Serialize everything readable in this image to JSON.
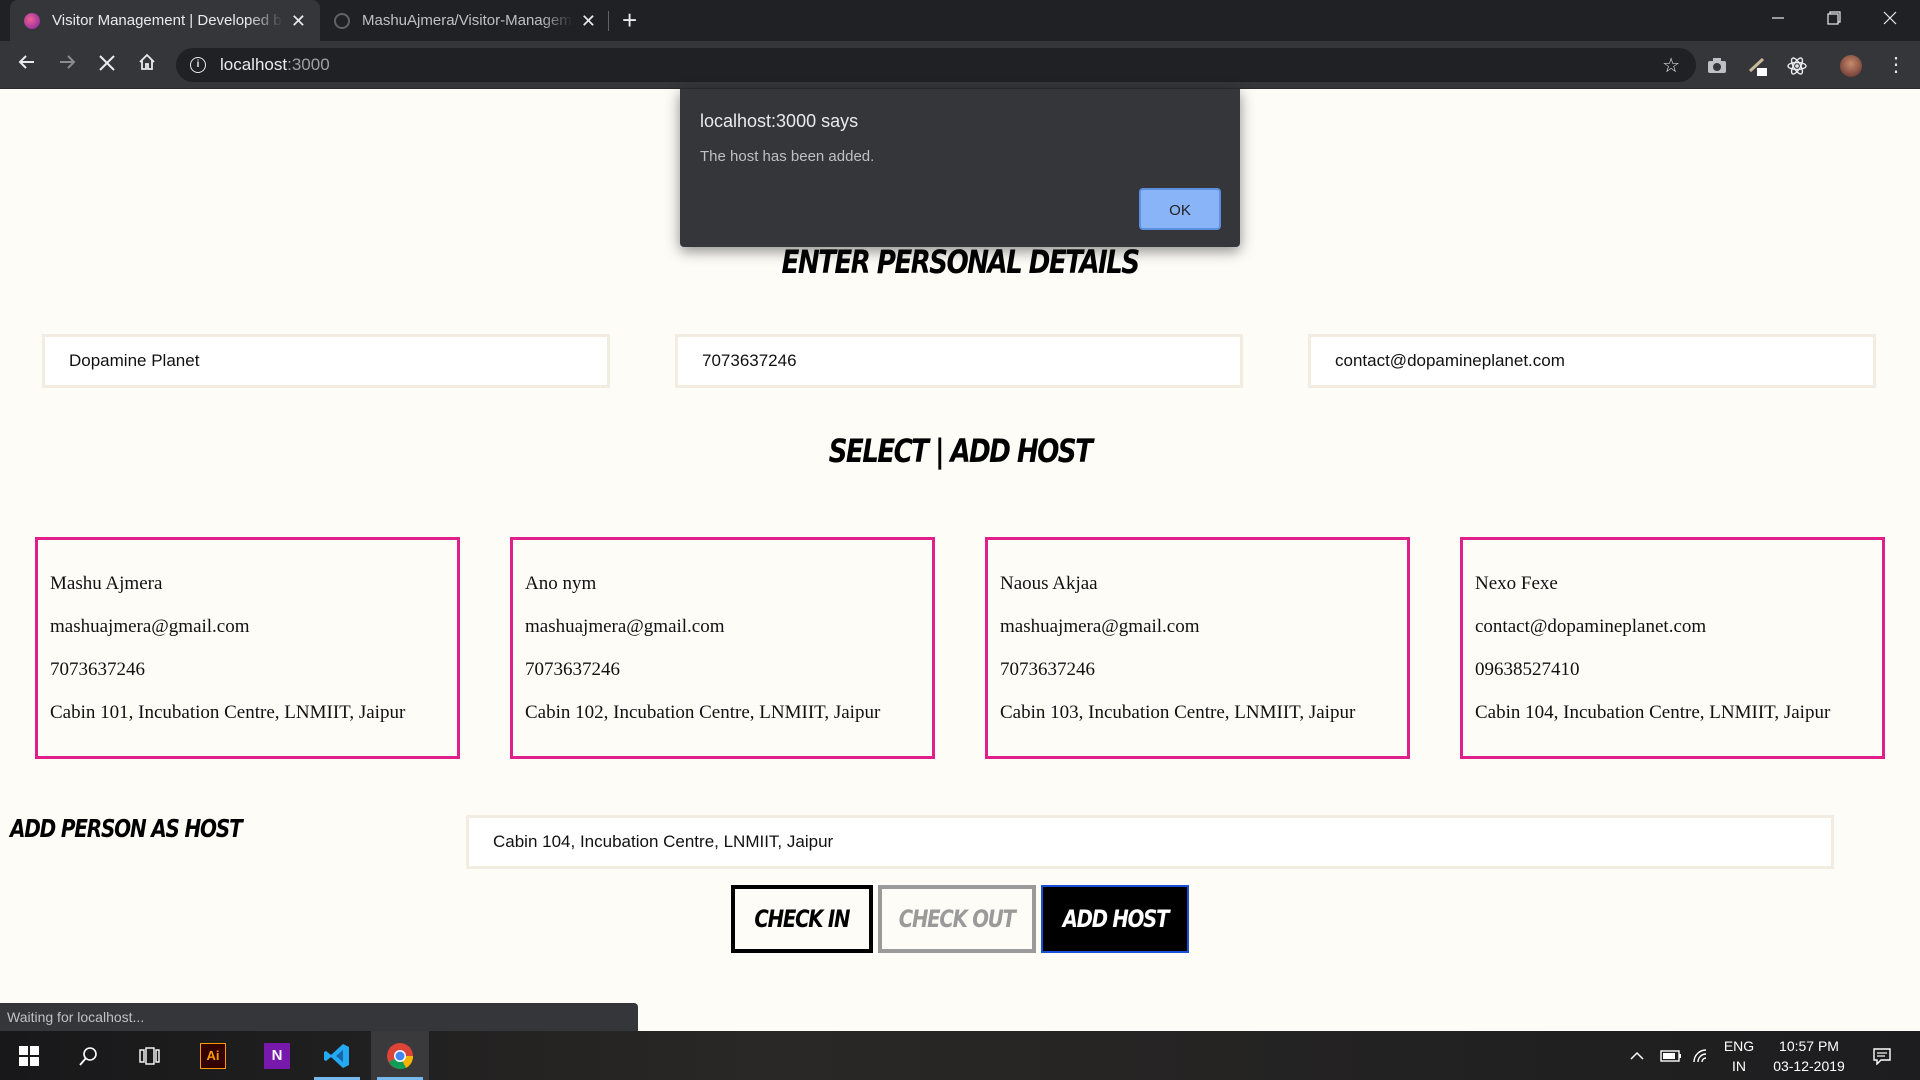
{
  "browser": {
    "tabs": [
      {
        "title": "Visitor Management | Developed by MashuAjmera",
        "close": "✕"
      },
      {
        "title": "MashuAjmera/Visitor-Management",
        "close": "✕"
      }
    ],
    "new_tab": "+",
    "url_host": "localhost",
    "url_port": ":3000",
    "info_glyph": "i",
    "star_glyph": "☆"
  },
  "dialog": {
    "title": "localhost:3000 says",
    "message": "The host has been added.",
    "ok_label": "OK"
  },
  "page": {
    "personal_heading": "ENTER PERSONAL DETAILS",
    "fields": {
      "name": "Dopamine Planet",
      "phone": "7073637246",
      "email": "contact@dopamineplanet.com"
    },
    "host_heading": "SELECT | ADD HOST",
    "hosts": [
      {
        "name": "Mashu Ajmera",
        "email": "mashuajmera@gmail.com",
        "phone": "7073637246",
        "address": "Cabin 101, Incubation Centre, LNMIIT, Jaipur"
      },
      {
        "name": "Ano nym",
        "email": "mashuajmera@gmail.com",
        "phone": "7073637246",
        "address": "Cabin 102, Incubation Centre, LNMIIT, Jaipur"
      },
      {
        "name": "Naous Akjaa",
        "email": "mashuajmera@gmail.com",
        "phone": "7073637246",
        "address": "Cabin 103, Incubation Centre, LNMIIT, Jaipur"
      },
      {
        "name": "Nexo Fexe",
        "email": "contact@dopamineplanet.com",
        "phone": "09638527410",
        "address": "Cabin 104, Incubation Centre, LNMIIT, Jaipur"
      }
    ],
    "add_person_label": "ADD PERSON AS HOST",
    "add_host_address": "Cabin 104, Incubation Centre, LNMIIT, Jaipur",
    "buttons": {
      "check_in": "CHECK IN",
      "check_out": "CHECK OUT",
      "add_host": "ADD HOST"
    }
  },
  "status_bar": "Waiting for localhost...",
  "taskbar": {
    "language_line1": "ENG",
    "language_line2": "IN",
    "time": "10:57 PM",
    "date": "03-12-2019",
    "illustrator_label": "Ai",
    "onenote_label": "N"
  },
  "colors": {
    "card_border": "#e0208a",
    "page_bg": "#fdfcf7",
    "ok_button": "#8ab4f8"
  }
}
